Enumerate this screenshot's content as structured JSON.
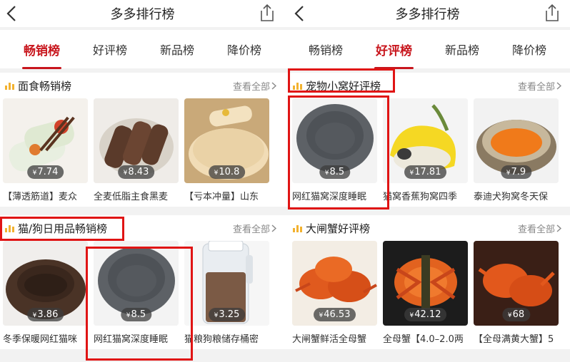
{
  "colors": {
    "accent": "#c8161d",
    "highlight_box": "#e01414"
  },
  "screens": [
    {
      "title": "多多排行榜",
      "tabs": [
        "畅销榜",
        "好评榜",
        "新品榜",
        "降价榜"
      ],
      "active_tab": 0,
      "sections": [
        {
          "title": "面食畅销榜",
          "view_all": "查看全部",
          "items": [
            {
              "price": "7.74",
              "name": "【薄透筋道】麦众"
            },
            {
              "price": "8.43",
              "name": "全麦低脂主食黑麦"
            },
            {
              "price": "10.8",
              "name": "【亏本冲量】山东"
            }
          ]
        },
        {
          "title": "猫/狗日用品畅销榜",
          "view_all": "查看全部",
          "items": [
            {
              "price": "3.86",
              "name": "冬季保暖网红猫咪"
            },
            {
              "price": "8.5",
              "name": "网红猫窝深度睡眠"
            },
            {
              "price": "3.25",
              "name": "猫粮狗粮储存桶密"
            }
          ]
        }
      ]
    },
    {
      "title": "多多排行榜",
      "tabs": [
        "畅销榜",
        "好评榜",
        "新品榜",
        "降价榜"
      ],
      "active_tab": 1,
      "sections": [
        {
          "title": "宠物小窝好评榜",
          "view_all": "查看全部",
          "items": [
            {
              "price": "8.5",
              "name": "网红猫窝深度睡眠"
            },
            {
              "price": "17.81",
              "name": "猫窝香蕉狗窝四季"
            },
            {
              "price": "7.9",
              "name": "泰迪犬狗窝冬天保"
            }
          ]
        },
        {
          "title": "大闸蟹好评榜",
          "view_all": "查看全部",
          "items": [
            {
              "price": "46.53",
              "name": "大闸蟹鲜活全母蟹"
            },
            {
              "price": "42.12",
              "name": "全母蟹【4.0–2.0两"
            },
            {
              "price": "68",
              "name": "【全母满黄大蟹】5"
            }
          ]
        }
      ]
    }
  ],
  "currency_symbol": "¥"
}
